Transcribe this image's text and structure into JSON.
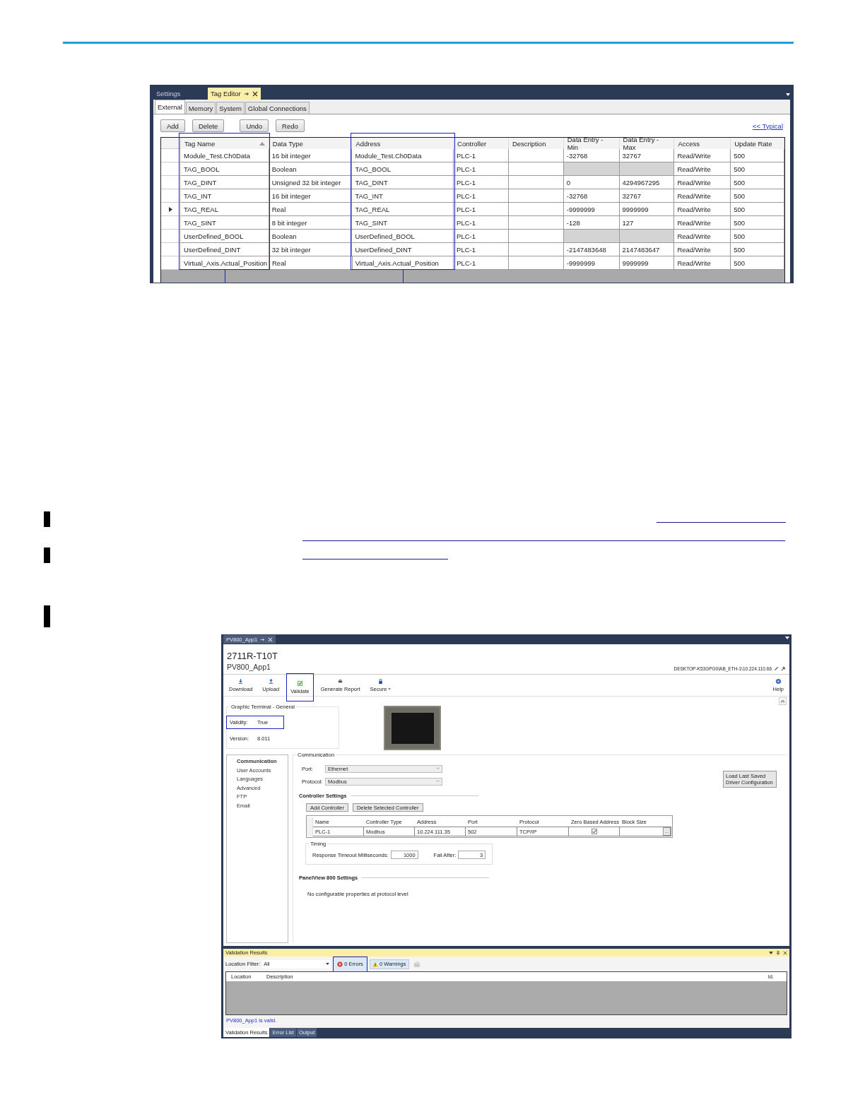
{
  "tag_editor": {
    "doc_tabs": [
      {
        "label": "Settings",
        "selected": false
      },
      {
        "label": "Tag Editor",
        "selected": true
      }
    ],
    "tabs": [
      {
        "label": "External",
        "selected": true
      },
      {
        "label": "Memory",
        "selected": false
      },
      {
        "label": "System",
        "selected": false
      },
      {
        "label": "Global Connections",
        "selected": false
      }
    ],
    "buttons": [
      "Add",
      "Delete",
      "Undo",
      "Redo"
    ],
    "link": "<< Typical",
    "columns": [
      {
        "label": "Tag Name",
        "sorted": true,
        "highlighted": true
      },
      {
        "label": "Data Type",
        "sorted": false,
        "highlighted": false
      },
      {
        "label": "Address",
        "sorted": false,
        "highlighted": true
      },
      {
        "label": "Controller",
        "sorted": false,
        "highlighted": false
      },
      {
        "label": "Description",
        "sorted": false,
        "highlighted": false
      },
      {
        "label": "Data Entry - Min",
        "sorted": false,
        "highlighted": false
      },
      {
        "label": "Data Entry - Max",
        "sorted": false,
        "highlighted": false
      },
      {
        "label": "Access",
        "sorted": false,
        "highlighted": false
      },
      {
        "label": "Update Rate",
        "sorted": false,
        "highlighted": false
      }
    ],
    "rows": [
      {
        "current": false,
        "range_editable": true,
        "tag": "Module_Test.Ch0Data",
        "type": "16 bit integer",
        "address": "Module_Test.Ch0Data",
        "controller": "PLC-1",
        "min": "-32768",
        "max": "32767",
        "access": "Read/Write",
        "rate": "500"
      },
      {
        "current": false,
        "range_editable": false,
        "tag": "TAG_BOOL",
        "type": "Boolean",
        "address": "TAG_BOOL",
        "controller": "PLC-1",
        "access": "Read/Write",
        "rate": "500"
      },
      {
        "current": false,
        "range_editable": true,
        "tag": "TAG_DINT",
        "type": "Unsigned 32 bit integer",
        "address": "TAG_DINT",
        "controller": "PLC-1",
        "min": "0",
        "max": "4294967295",
        "access": "Read/Write",
        "rate": "500"
      },
      {
        "current": false,
        "range_editable": true,
        "tag": "TAG_INT",
        "type": "16 bit integer",
        "address": "TAG_INT",
        "controller": "PLC-1",
        "min": "-32768",
        "max": "32767",
        "access": "Read/Write",
        "rate": "500"
      },
      {
        "current": true,
        "range_editable": true,
        "tag": "TAG_REAL",
        "type": "Real",
        "address": "TAG_REAL",
        "controller": "PLC-1",
        "min": "-9999999",
        "max": "9999999",
        "access": "Read/Write",
        "rate": "500"
      },
      {
        "current": false,
        "range_editable": true,
        "tag": "TAG_SINT",
        "type": "8 bit integer",
        "address": "TAG_SINT",
        "controller": "PLC-1",
        "min": "-128",
        "max": "127",
        "access": "Read/Write",
        "rate": "500"
      },
      {
        "current": false,
        "range_editable": false,
        "tag": "UserDefined_BOOL",
        "type": "Boolean",
        "address": "UserDefined_BOOL",
        "controller": "PLC-1",
        "access": "Read/Write",
        "rate": "500"
      },
      {
        "current": false,
        "range_editable": true,
        "tag": "UserDefined_DINT",
        "type": "32 bit integer",
        "address": "UserDefined_DINT",
        "controller": "PLC-1",
        "min": "-2147483648",
        "max": "2147483647",
        "access": "Read/Write",
        "rate": "500"
      },
      {
        "current": false,
        "range_editable": true,
        "tag": "Virtual_Axis.Actual_Position",
        "type": "Real",
        "address": "Virtual_Axis.Actual_Position",
        "controller": "PLC-1",
        "min": "-9999999",
        "max": "9999999",
        "access": "Read/Write",
        "rate": "500"
      }
    ]
  },
  "app": {
    "tab": "PV800_App1",
    "model": "2711R-T10T",
    "name": "PV800_App1",
    "connection": "DESKTOP-K53GPG0IAB_ETH-1\\10.224.110.66",
    "toolbar": [
      {
        "label": "Download",
        "kind": "download",
        "highlighted": false,
        "menu": false
      },
      {
        "label": "Upload",
        "kind": "upload",
        "highlighted": false,
        "menu": false
      },
      {
        "label": "Validate",
        "kind": "validate",
        "highlighted": true,
        "menu": false
      },
      {
        "label": "Generate Report",
        "kind": "report",
        "highlighted": false,
        "menu": false
      },
      {
        "label": "Secure",
        "kind": "secure",
        "highlighted": false,
        "menu": true
      }
    ],
    "help": "Help",
    "general": {
      "title": "Graphic Terminal - General",
      "fields": [
        {
          "label": "Validity:",
          "value": "True",
          "highlighted": true
        },
        {
          "label": "Version:",
          "value": "8.011",
          "highlighted": false
        }
      ]
    },
    "nav": [
      {
        "label": "Communication",
        "selected": true
      },
      {
        "label": "User Accounts",
        "selected": false
      },
      {
        "label": "Languages",
        "selected": false
      },
      {
        "label": "Advanced",
        "selected": false
      },
      {
        "label": "FTP",
        "selected": false
      },
      {
        "label": "Email",
        "selected": false
      }
    ],
    "communication": {
      "title": "Communication",
      "port": {
        "label": "Port:",
        "value": "Ethernet"
      },
      "protocol": {
        "label": "Protocol:",
        "value": "Modbus"
      },
      "load_button": "Load Last Saved Driver Configuration",
      "controller_settings": {
        "title": "Controller Settings",
        "buttons": [
          "Add Controller",
          "Delete Selected Controller"
        ],
        "columns": [
          "Name",
          "Controller Type",
          "Address",
          "Port",
          "Protocol",
          "Zero Based Address",
          "Block Size"
        ],
        "rows": [
          {
            "name": "PLC-1",
            "type": "Modbus",
            "address": "10.224.111.35",
            "port": "502",
            "protocol": "TCP/IP",
            "zero_based_address": true,
            "browse": "..."
          }
        ]
      },
      "timing": {
        "title": "Timing",
        "timeout": {
          "label": "Response Timeout Milliseconds:",
          "value": "1000"
        },
        "fail_after": {
          "label": "Fail After:",
          "value": "3"
        }
      },
      "panelview": {
        "title": "PanelView 800 Settings",
        "message": "No configurable properties at protocol level"
      }
    },
    "results": {
      "title": "Validation Results",
      "filter": {
        "label": "Location Filter:",
        "value": "All"
      },
      "errors": {
        "label": "0 Errors",
        "highlighted": true
      },
      "warnings": {
        "label": "0 Warnings",
        "highlighted": false
      },
      "columns": [
        "Location",
        "Description",
        "Id."
      ],
      "status": "PV800_App1 is valid.",
      "bottom_tabs": [
        {
          "label": "Validation Results",
          "selected": true
        },
        {
          "label": "Error List",
          "selected": false
        },
        {
          "label": "Output",
          "selected": false
        }
      ]
    }
  }
}
